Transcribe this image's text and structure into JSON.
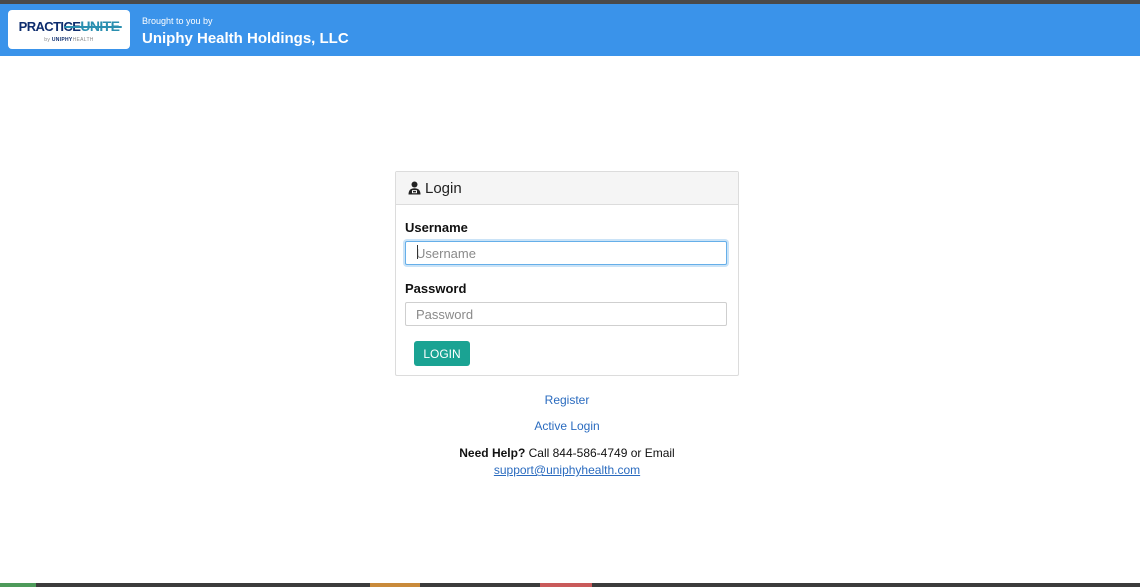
{
  "header": {
    "logo": {
      "practice": "PRACTICE",
      "unite": "UNITE",
      "sub_prefix": "by",
      "sub_brand": "UNIPHY",
      "sub_suffix": "HEALTH"
    },
    "brought_label": "Brought to you by",
    "company": "Uniphy Health Holdings, LLC",
    "color": "#3a93ea"
  },
  "login_panel": {
    "title": "Login",
    "title_icon": "user-icon",
    "username": {
      "label": "Username",
      "placeholder": "Username",
      "value": ""
    },
    "password": {
      "label": "Password",
      "placeholder": "Password",
      "value": ""
    },
    "login_button": "LOGIN",
    "button_color": "#1aa393"
  },
  "links": {
    "register": "Register",
    "active_login": "Active Login",
    "help_bold": "Need Help?",
    "help_text": "Call 844-586-4749 or Email",
    "help_email": "support@uniphyhealth.com"
  },
  "bottom_bar": {
    "colors": [
      "#4d9a5a",
      "#c98a3a",
      "#c95a5a"
    ]
  }
}
